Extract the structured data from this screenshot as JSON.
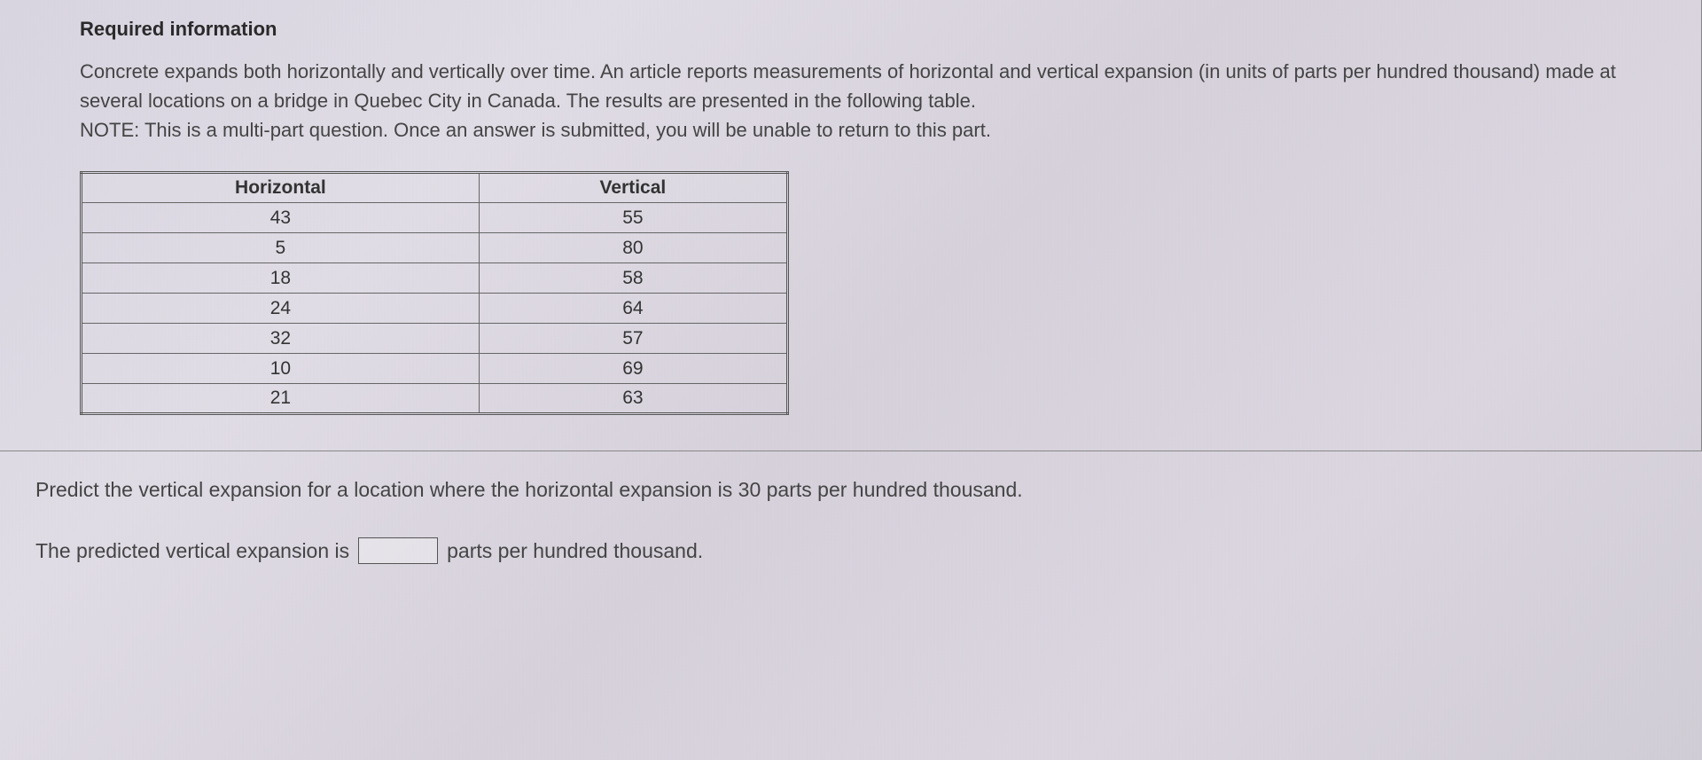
{
  "info_box": {
    "title": "Required information",
    "description": "Concrete expands both horizontally and vertically over time. An article reports measurements of horizontal and vertical expansion (in units of parts per hundred thousand) made at several locations on a bridge in Quebec City in Canada. The results are presented in the following table.",
    "note": "NOTE: This is a multi-part question. Once an answer is submitted, you will be unable to return to this part."
  },
  "table": {
    "headers": [
      "Horizontal",
      "Vertical"
    ],
    "rows": [
      [
        "43",
        "55"
      ],
      [
        "5",
        "80"
      ],
      [
        "18",
        "58"
      ],
      [
        "24",
        "64"
      ],
      [
        "32",
        "57"
      ],
      [
        "10",
        "69"
      ],
      [
        "21",
        "63"
      ]
    ]
  },
  "question": {
    "prompt": "Predict the vertical expansion for a location where the horizontal expansion is 30 parts per hundred thousand.",
    "answer_prefix": "The predicted vertical expansion is",
    "answer_suffix": "parts per hundred thousand.",
    "answer_value": ""
  }
}
